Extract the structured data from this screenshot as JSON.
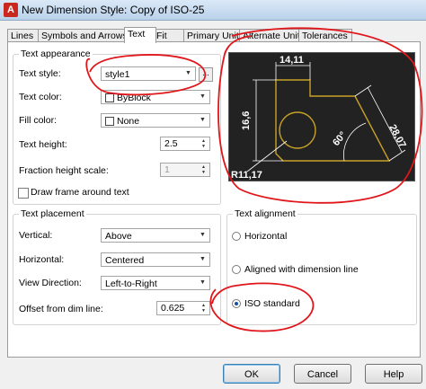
{
  "window": {
    "title": "New Dimension Style: Copy of ISO-25"
  },
  "tabs": [
    {
      "label": "Lines"
    },
    {
      "label": "Symbols and Arrows"
    },
    {
      "label": "Text"
    },
    {
      "label": "Fit"
    },
    {
      "label": "Primary Units"
    },
    {
      "label": "Alternate Units"
    },
    {
      "label": "Tolerances"
    }
  ],
  "text_appearance": {
    "title": "Text appearance",
    "text_style_label": "Text style:",
    "text_style_value": "style1",
    "browse_label": "...",
    "text_color_label": "Text color:",
    "text_color_value": "ByBlock",
    "fill_color_label": "Fill color:",
    "fill_color_value": "None",
    "text_height_label": "Text height:",
    "text_height_value": "2.5",
    "fraction_label": "Fraction height scale:",
    "fraction_value": "1",
    "frame_label": "Draw frame around text"
  },
  "preview": {
    "dim_top": "14,11",
    "dim_left": "16,6",
    "dim_right": "28,07",
    "angle": "60°",
    "radius": "R11,17",
    "colors": {
      "background": "#222222",
      "outline": "#c9a227",
      "dims": "#ffffff"
    }
  },
  "text_placement": {
    "title": "Text placement",
    "vertical_label": "Vertical:",
    "vertical_value": "Above",
    "horizontal_label": "Horizontal:",
    "horizontal_value": "Centered",
    "view_label": "View Direction:",
    "view_value": "Left-to-Right",
    "offset_label": "Offset from dim line:",
    "offset_value": "0.625"
  },
  "text_alignment": {
    "title": "Text alignment",
    "options": [
      {
        "label": "Horizontal",
        "selected": false
      },
      {
        "label": "Aligned with dimension line",
        "selected": false
      },
      {
        "label": "ISO standard",
        "selected": true
      }
    ]
  },
  "buttons": {
    "ok": "OK",
    "cancel": "Cancel",
    "help": "Help"
  },
  "annotation_color": "#e0161b"
}
